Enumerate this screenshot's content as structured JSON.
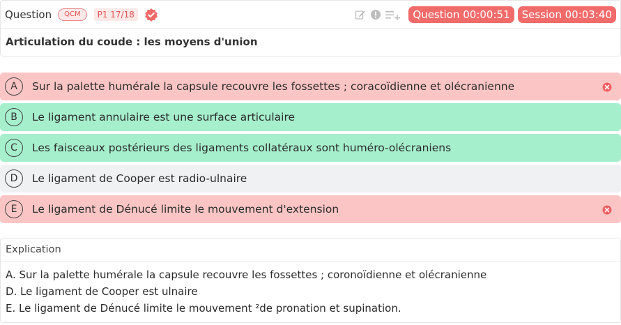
{
  "header": {
    "question_label": "Question",
    "type_badge": "QCM",
    "position_badge": "P1 17/18",
    "icons": [
      "verified-badge-icon",
      "edit-icon",
      "report-icon",
      "add-to-list-icon"
    ],
    "question_timer": "Question 00:00:51",
    "session_timer": "Session 00:03:40"
  },
  "question": {
    "title": "Articulation du coude : les moyens d'union"
  },
  "answers": [
    {
      "letter": "A",
      "text": "Sur la palette humérale la capsule recouvre les fossettes ; coracoïdienne et olécranienne",
      "status": "wrong"
    },
    {
      "letter": "B",
      "text": "Le ligament annulaire est une surface articulaire",
      "status": "right"
    },
    {
      "letter": "C",
      "text": "Les faisceaux postérieurs des ligaments collatéraux sont huméro-olécraniens",
      "status": "right"
    },
    {
      "letter": "D",
      "text": "Le ligament de Cooper est radio-ulnaire",
      "status": "neutral"
    },
    {
      "letter": "E",
      "text": "Le ligament de Dénucé limite le mouvement d'extension",
      "status": "wrong"
    }
  ],
  "explication": {
    "title": "Explication",
    "lines": [
      "A. Sur la palette humérale la capsule recouvre les fossettes ; coronoïdienne et olécranienne",
      "D. Le ligament de Cooper est ulnaire",
      "E. Le ligament de Dénucé limite le mouvement ²de pronation et supination."
    ]
  },
  "colors": {
    "accent_red": "#f26b6b",
    "wrong_bg": "#fcc5c5",
    "right_bg": "#a6efcd",
    "neutral_bg": "#f0f1f3"
  }
}
